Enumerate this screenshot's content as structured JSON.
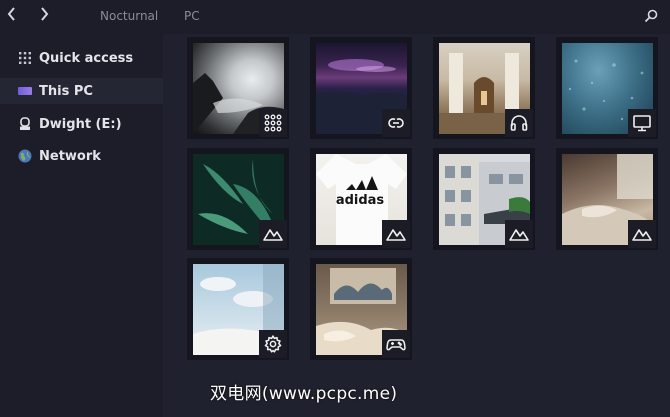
{
  "titlebar": {
    "back_label": "‹",
    "forward_label": "›",
    "breadcrumb": [
      "Nocturnal",
      "PC"
    ],
    "search_icon": "search-icon"
  },
  "sidebar": {
    "items": [
      {
        "label": "Quick access",
        "icon": "grid-dots-icon"
      },
      {
        "label": "This PC",
        "icon": "monitor-icon",
        "active": true
      },
      {
        "label": "Dwight (E:)",
        "icon": "usb-drive-icon"
      },
      {
        "label": "Network",
        "icon": "globe-icon"
      }
    ]
  },
  "tiles": [
    {
      "image": "misty-mountains",
      "badge": "apps-grid-icon"
    },
    {
      "image": "purple-night-sea",
      "badge": "link-icon"
    },
    {
      "image": "ornate-hall",
      "badge": "headphones-icon"
    },
    {
      "image": "rain-window",
      "badge": "monitor-icon"
    },
    {
      "image": "fern-leaves",
      "badge": "mountain-icon"
    },
    {
      "image": "adidas-shirt",
      "badge": "mountain-icon",
      "image_text": "adidas"
    },
    {
      "image": "building-facade",
      "badge": "mountain-icon"
    },
    {
      "image": "bedroom-window",
      "badge": "mountain-icon"
    },
    {
      "image": "sky-wall-room",
      "badge": "gear-icon"
    },
    {
      "image": "wave-poster-bed",
      "badge": "gamepad-icon"
    }
  ],
  "watermark": "双电网(www.pcpc.me)",
  "colors": {
    "background": "#20212e",
    "sidebar": "#1c1d29",
    "tile_frame": "#15151f",
    "active_item": "#252634"
  }
}
